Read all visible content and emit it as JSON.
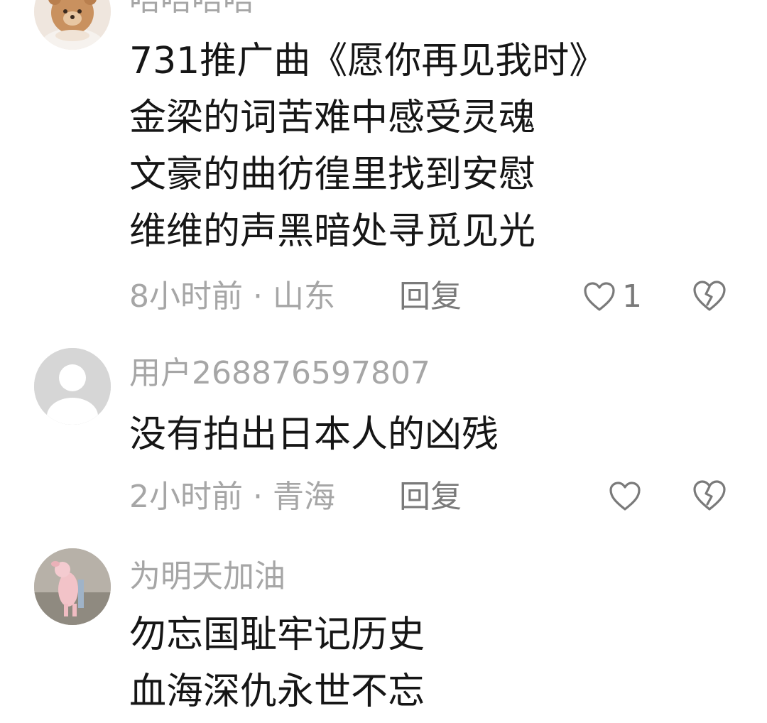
{
  "comments": [
    {
      "username": "唔唔唔唔",
      "lines": [
        "731推广曲《愿你再见我时》",
        "金梁的词苦难中感受灵魂",
        "文豪的曲彷徨里找到安慰",
        "维维的声黑暗处寻觅见光"
      ],
      "time": "8小时前",
      "location": "山东",
      "reply_label": "回复",
      "like_count": "1",
      "avatar": "bear-avatar"
    },
    {
      "username": "用户268876597807",
      "lines": [
        "没有拍出日本人的凶残"
      ],
      "time": "2小时前",
      "location": "青海",
      "reply_label": "回复",
      "like_count": "",
      "avatar": "default-avatar"
    },
    {
      "username": "为明天加油",
      "lines": [
        "勿忘国耻牢记历史",
        "血海深仇永世不忘"
      ],
      "avatar": "pig-avatar"
    }
  ],
  "separator": " · ",
  "colors": {
    "text": "#161616",
    "muted": "#a6a6a6",
    "action": "#7a7a7a"
  },
  "icons": {
    "like": "heart-outline-icon",
    "dislike": "broken-heart-icon"
  }
}
